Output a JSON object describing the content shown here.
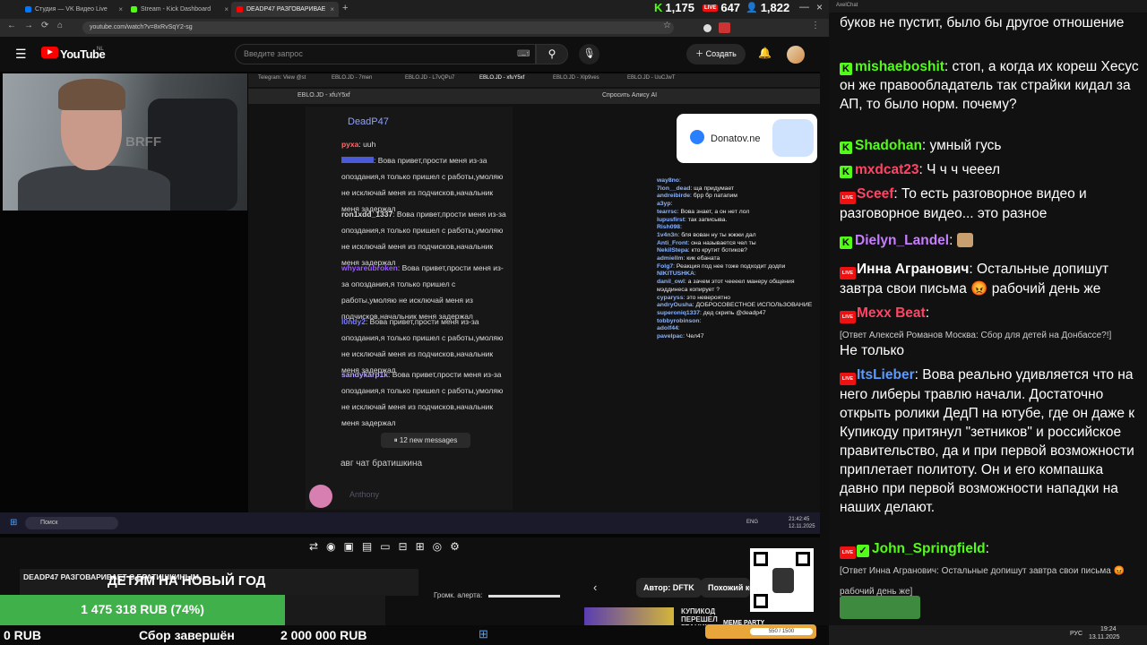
{
  "browser": {
    "tabs": [
      {
        "label": "Студия — VK Видео Live",
        "color": "#0077ff"
      },
      {
        "label": "Stream - Kick Dashboard",
        "color": "#53fc18"
      },
      {
        "label": "DEADP47 РАЗГОВАРИВАЕ",
        "color": "#ff0000"
      }
    ],
    "url": "youtube.com/watch?v=8xRvSqY2-sg",
    "new_tab": "+",
    "close": "×"
  },
  "stats": {
    "kick_viewers": "1,175",
    "vk_viewers": "647",
    "other_viewers": "1,822"
  },
  "youtube": {
    "logo_text": "YouTube",
    "region": "NL",
    "search_placeholder": "Введите запрос",
    "create_label": "Создать"
  },
  "stream": {
    "webcam_overlay": "BRFF",
    "inner_tabs": [
      "Telegram: View @st",
      "EBLO.JD - 7men",
      "EBLO.JD - L7vQPu7",
      "EBLO.JD - xfuY5xf",
      "EBLO.JD - Xlp9ves",
      "EBLO.JD - UuCJwT"
    ],
    "inner_title": "EBLO.JD - xfuY5xf",
    "inner_alice": "Спросить Алису AI",
    "kick_chat_header": "DeadP47",
    "kick_chat": [
      {
        "user": "руха",
        "color": "#ff6b6b",
        "text": "uuh"
      },
      {
        "user": "",
        "color": "#5b6bff",
        "text": "Вова привет,прости меня из-за опоздания,я только пришел с работы,умоляю не исключай меня из подчисков,начальник меня задержал"
      },
      {
        "user": "ron1xdd_1337",
        "color": "#ffffff",
        "text": "Вова привет,прости меня из-за опоздания,я только пришел с работы,умоляю не исключай меня из подчисков,начальник меня задержал"
      },
      {
        "user": "whyareubroken",
        "color": "#9b59ff",
        "text": "Вова привет,прости меня из-за опоздания,я только пришел с работы,умоляю не исключай меня из подчисков,начальник меня задержал"
      },
      {
        "user": "l0ndy2",
        "color": "#7a7aff",
        "text": "Вова привет,прости меня из-за опоздания,я только пришел с работы,умоляю не исключай меня из подчисков,начальник меня задержал"
      },
      {
        "user": "sandykarp1k",
        "color": "#b7a2ff",
        "text": "Вова привет,прости меня из-за опоздания,я только пришел с работы,умоляю не исключай меня из подчисков,начальник меня задержал"
      }
    ],
    "new_messages": "12 new messages",
    "inner_input": "авг чат братишкина",
    "inner_input_user": "Anthony",
    "donatov": "Donatov.ne",
    "overlay_chat": [
      {
        "user": "way8no",
        "text": ""
      },
      {
        "user": "7ion__dead",
        "text": "ща придумает"
      },
      {
        "user": "andreibirde",
        "text": "брр бр патапим"
      },
      {
        "user": "a3yp",
        "text": ""
      },
      {
        "user": "tearrsc",
        "text": "Вова знает, а он нет лол"
      },
      {
        "user": "lupusfirst",
        "text": "так записыва."
      },
      {
        "user": "Rish098",
        "text": ""
      },
      {
        "user": "1v4n3n",
        "text": "бля вован ну ты жжжи дал"
      },
      {
        "user": "Anti_Front",
        "text": "она называется чел ты"
      },
      {
        "user": "NekilStepa",
        "text": "кто крутит ботиков?"
      },
      {
        "user": "admiellm",
        "text": "кик ебаната"
      },
      {
        "user": "Folg7",
        "text": "Реакция под нее тоже подходит додпи"
      },
      {
        "user": "NIKITUSHKA",
        "text": ""
      },
      {
        "user": "danil_owl",
        "text": "а зачем этот чеееел манеру общения мэддинеса копирует ?"
      },
      {
        "user": "cyparyss",
        "text": "это невероятно"
      },
      {
        "user": "andryOusha",
        "text": "ДОБРОСОВЕСТНОЕ ИСПОЛЬЗОВАНИЕ"
      },
      {
        "user": "superoniq1337",
        "text": "дед скрипь @deadp47"
      },
      {
        "user": "tobbyrobinson",
        "text": ""
      },
      {
        "user": "adolf44",
        "text": ""
      },
      {
        "user": "pavelpac",
        "text": "Чел47"
      }
    ],
    "taskbar_search": "Поиск",
    "taskbar_lang": "ENG",
    "taskbar_time": "21:42:45",
    "taskbar_date": "12.11.2025"
  },
  "bottom": {
    "title_overlay": "DEADP47 РАЗГОВАРИВАЕТ С БРАТИШКИНЫМ",
    "banner": "ДЕТЯМ НА НОВЫЙ ГОД",
    "progress_label": "1 475 318 RUB (74%)",
    "progress_fraction": 0.74,
    "left_amount": "0 RUB",
    "status": "Сбор завершён",
    "goal": "2 000 000 RUB",
    "alert_label": "Громк. алерта:",
    "author_pill": "Автор: DFTK",
    "similar_pill": "Похожий ко",
    "recommend_title": "КУПИКОД ПЕРЕШЕЛ ГРАНИЦЫ",
    "meme_label": "MEME PARTY",
    "meme_value": "550 / 1500"
  },
  "chat": {
    "title": "AxelChat",
    "messages": [
      {
        "platform": "",
        "user": "",
        "color": "#fff",
        "text": "буков не пустит, было бы другое отношение"
      },
      {
        "platform": "kick",
        "user": "mishaeboshit",
        "color": "#53fc18",
        "text": "стоп, а когда их кореш Хесус он же правообладатель так страйки кидал за АП, то было норм. почему?"
      },
      {
        "platform": "kick",
        "user": "Shadohan",
        "color": "#53fc18",
        "text": "умный гусь"
      },
      {
        "platform": "kick",
        "user": "mxdcat23",
        "color": "#ff4466",
        "text": "Ч ч ч чееел"
      },
      {
        "platform": "vk",
        "user": "Sceef",
        "color": "#ff4466",
        "text": "То есть разговорное видео и разговорное видео... это разное"
      },
      {
        "platform": "kick",
        "user": "Dielyn_Landel",
        "color": "#c77dff",
        "text": ""
      },
      {
        "platform": "vk",
        "user": "Инна Агранович",
        "color": "#ffffff",
        "text": "Остальные допишут завтра свои письма 😡 рабочий день же"
      },
      {
        "platform": "vk",
        "user": "Mexx Beat",
        "color": "#ff4466",
        "text": ""
      },
      {
        "platform": "",
        "user": "",
        "color": "#ccc",
        "reply": "[Ответ Алексей Романов Москва: Сбор для детей на Донбассе?!]",
        "text": "Не только"
      },
      {
        "platform": "vk",
        "user": "ItsLieber",
        "color": "#5b9bff",
        "text": "Вова реально удивляется что на него либеры травлю начали. Достаточно открыть ролики ДедП на ютубе, где он даже к Купикоду притянул \"зетников\" и российское правительство, да и при первой возможности приплетает политоту. Он и его компашка давно при первой возможности нападки на наших делают."
      },
      {
        "platform": "vk",
        "user": "John_Springfield",
        "color": "#53fc18",
        "text": ""
      },
      {
        "platform": "",
        "user": "",
        "color": "#ccc",
        "reply": "[Ответ Инна Агранович: Остальные допишут завтра свои письма 😡 рабочий день же]",
        "text": ""
      }
    ]
  },
  "windows": {
    "lang": "РУС",
    "time": "19:24",
    "date": "13.11.2025"
  },
  "colors": {
    "kick": "#53fc18",
    "youtube": "#ff0000",
    "vk_live": "#e11111",
    "progress": "#3fb04a"
  }
}
